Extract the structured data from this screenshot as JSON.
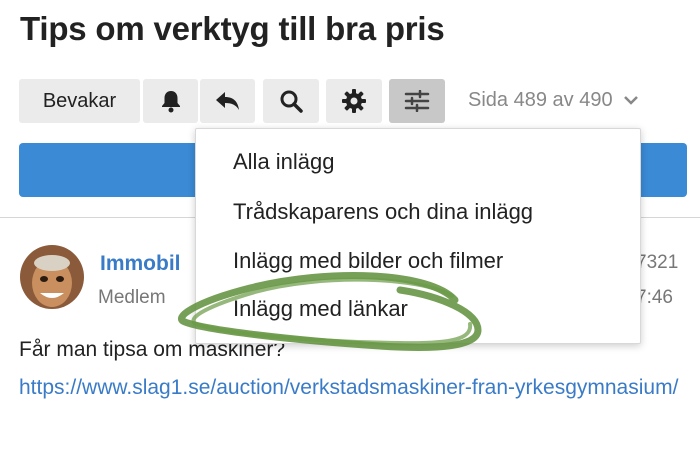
{
  "thread": {
    "title": "Tips om verktyg till bra pris"
  },
  "toolbar": {
    "watch_label": "Bevakar",
    "icons": [
      "bell-icon",
      "reply-icon",
      "search-icon",
      "gear-icon",
      "filter-sliders-icon"
    ],
    "page_indicator": "Sida 489 av 490"
  },
  "filter_menu": {
    "items": [
      {
        "label": "Alla inlägg"
      },
      {
        "label": "Trådskaparens och dina inlägg"
      },
      {
        "label": "Inlägg med bilder och filmer"
      },
      {
        "label": "Inlägg med länkar"
      }
    ]
  },
  "post": {
    "author": "Immobil",
    "role": "Medlem",
    "number_fragment": "7321",
    "time_fragment": "7:46",
    "text": "Får man tipsa om maskiner?",
    "link": "https://www.slag1.se/auction/verkstadsmaskiner-fran-yrkesgymnasium/"
  },
  "colors": {
    "accent": "#3a8ad6",
    "link": "#3a7bc8",
    "scribble": "#5e8f3a"
  }
}
